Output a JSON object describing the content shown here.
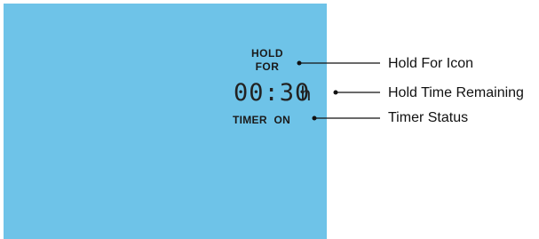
{
  "lcd": {
    "background_color": "#6ec3e8",
    "hold_for_line1": "HOLD",
    "hold_for_line2": "FOR",
    "hold_time_digits": "00:30",
    "hold_time_unit": "h",
    "timer_status": "TIMER ON"
  },
  "callouts": {
    "hold_for_icon": "Hold For Icon",
    "hold_time_remaining": "Hold Time Remaining",
    "timer_status": "Timer Status"
  }
}
